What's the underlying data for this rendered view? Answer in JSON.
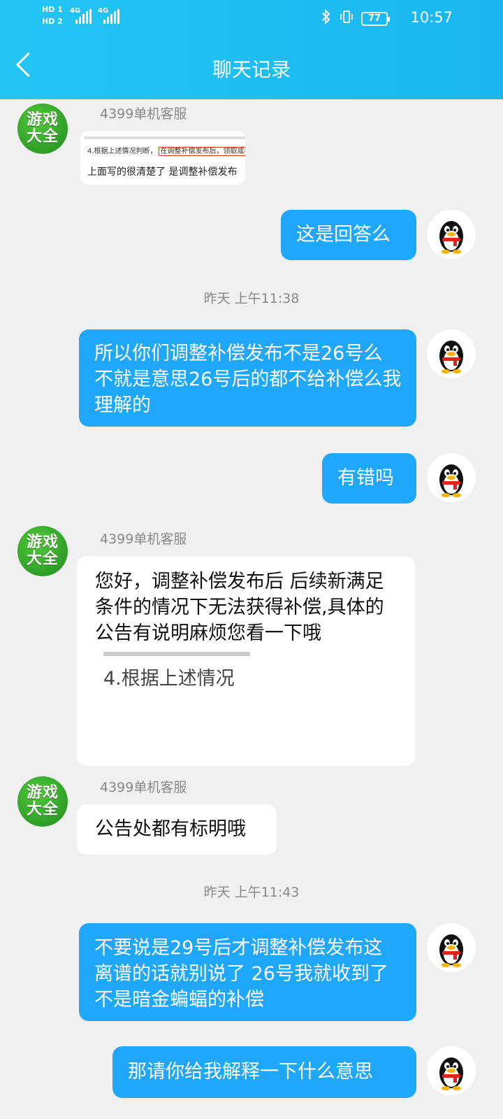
{
  "status_bar": {
    "sim1": "HD 1",
    "sim2": "HD 2",
    "net1": "4G",
    "net2": "4G",
    "battery": "77",
    "time": "10:57"
  },
  "header": {
    "title": "聊天记录",
    "back_icon": "chevron-left-icon"
  },
  "colors": {
    "header": "#1fbff3",
    "my_bubble": "#1ea7fb",
    "background": "#f0f0f0"
  },
  "avatars": {
    "agent_text_1": "游戏",
    "agent_text_2": "大全"
  },
  "messages": [
    {
      "sender": "4399单机客服",
      "image_line1": "4.根据上述情况判断，",
      "image_line1_boxed": "在调整补偿发布后，领取或者",
      "image_line2": "上面写的很清楚了 是调整补偿发布"
    },
    {
      "text": "这是回答么"
    },
    {
      "timestamp": "昨天 上午11:38"
    },
    {
      "text": "所以你们调整补偿发布不是26号么 不就是意思26号后的都不给补偿么我理解的"
    },
    {
      "text": "有错吗"
    },
    {
      "sender": "4399单机客服",
      "text": "您好，调整补偿发布后 后续新满足条件的情况下无法获得补偿,具体的公告有说明麻烦您看一下哦",
      "image_text": "4.根据上述情况"
    },
    {
      "sender": "4399单机客服",
      "text": "公告处都有标明哦"
    },
    {
      "timestamp": "昨天 上午11:43"
    },
    {
      "text": "不要说是29号后才调整补偿发布这离谱的话就别说了 26号我就收到了不是暗金蝙蝠的补偿"
    },
    {
      "text": "那请你给我解释一下什么意思"
    }
  ]
}
